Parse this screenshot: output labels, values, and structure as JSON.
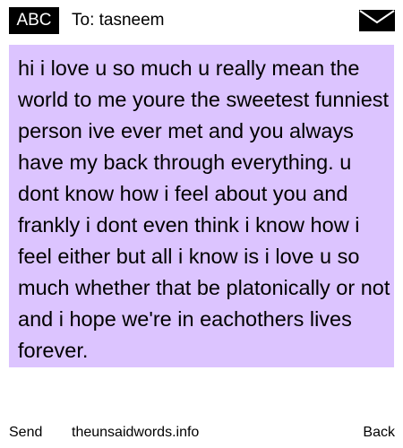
{
  "header": {
    "input_mode": "ABC",
    "recipient": "To: tasneem",
    "envelope_icon": "envelope-icon"
  },
  "message": {
    "body": "hi i love u so much u really mean the world to me youre the sweetest funniest person ive ever met and you always have my back through everything. u dont know how i feel about you and frankly i dont even think i know how i feel either but all i know is i love u so much whether that be platonically or not and i hope we're in eachothers lives forever.",
    "highlight_color": "#dcc4ff"
  },
  "footer": {
    "send_label": "Send",
    "site": "theunsaidwords.info",
    "back_label": "Back"
  }
}
